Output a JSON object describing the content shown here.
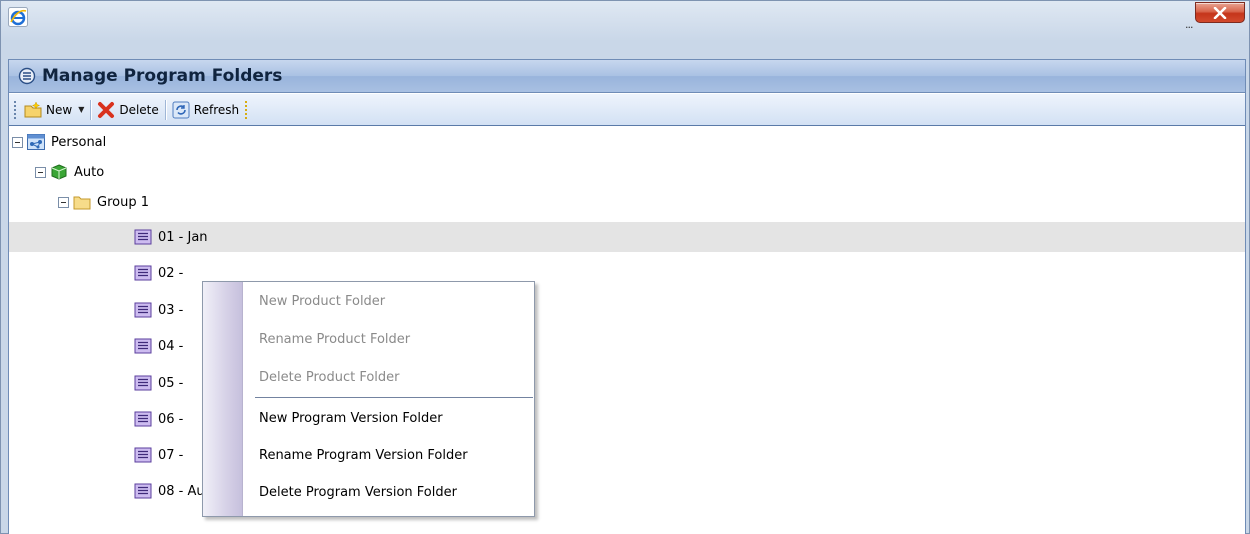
{
  "window": {
    "ellipsis": "...",
    "close_label": "X"
  },
  "dialog": {
    "title": "Manage Program Folders"
  },
  "toolbar": {
    "new_label": "New",
    "delete_label": "Delete",
    "refresh_label": "Refresh"
  },
  "tree": {
    "nodes": [
      {
        "label": "Personal",
        "level": 0,
        "icon": "network-folder-icon",
        "expanded": true
      },
      {
        "label": "Auto",
        "level": 1,
        "icon": "green-cube-icon",
        "expanded": true
      },
      {
        "label": "Group 1",
        "level": 2,
        "icon": "folder-icon",
        "expanded": true
      },
      {
        "label": "01 - Jan",
        "level": 3,
        "icon": "purple-list-folder-icon",
        "selected": true
      },
      {
        "label": "02 -",
        "level": 3,
        "icon": "purple-list-folder-icon"
      },
      {
        "label": "03 -",
        "level": 3,
        "icon": "purple-list-folder-icon"
      },
      {
        "label": "04 -",
        "level": 3,
        "icon": "purple-list-folder-icon"
      },
      {
        "label": "05 -",
        "level": 3,
        "icon": "purple-list-folder-icon"
      },
      {
        "label": "06 -",
        "level": 3,
        "icon": "purple-list-folder-icon"
      },
      {
        "label": "07 -",
        "level": 3,
        "icon": "purple-list-folder-icon"
      },
      {
        "label": "08 - Aug",
        "level": 3,
        "icon": "purple-list-folder-icon"
      }
    ]
  },
  "context_menu": {
    "items": [
      {
        "label": "New Product Folder",
        "enabled": false
      },
      {
        "label": "Rename Product Folder",
        "enabled": false
      },
      {
        "label": "Delete Product Folder",
        "enabled": false
      },
      {
        "label": "New Program Version Folder",
        "enabled": true
      },
      {
        "label": "Rename Program Version Folder",
        "enabled": true
      },
      {
        "label": "Delete Program Version Folder",
        "enabled": true
      }
    ]
  },
  "colors": {
    "header_bg": "#a9c1e3",
    "toolbar_bg": "#d3e1f4",
    "selected_row": "#e4e4e4",
    "disabled_text": "#8a8a8a"
  }
}
